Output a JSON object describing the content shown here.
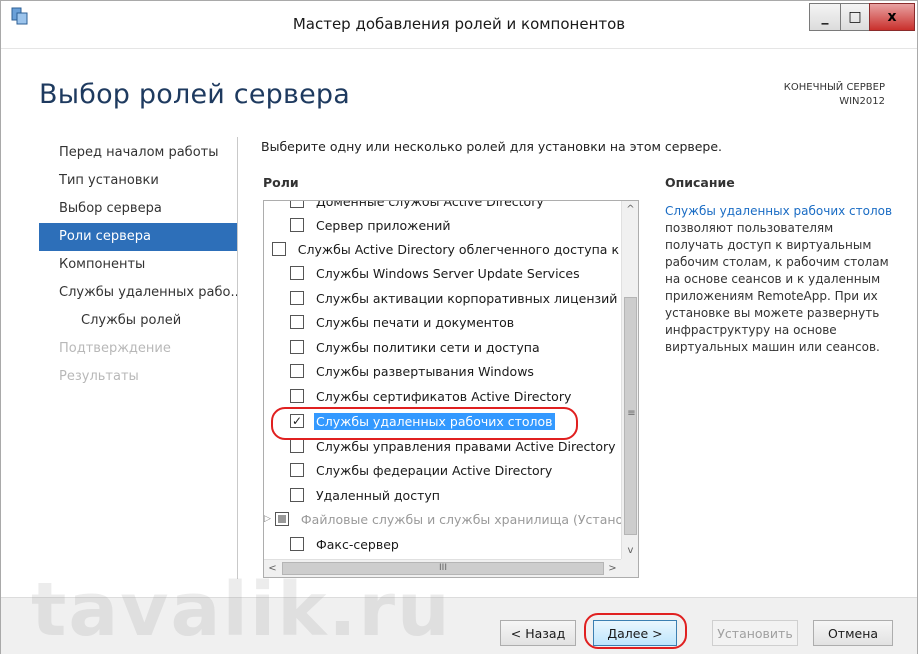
{
  "window": {
    "title": "Мастер добавления ролей и компонентов",
    "controls": {
      "minimize": "_",
      "maximize": "□",
      "close": "x"
    }
  },
  "header": {
    "title": "Выбор ролей сервера",
    "server_label": "КОНЕЧНЫЙ СЕРВЕР",
    "server_name": "WIN2012"
  },
  "nav": {
    "items": [
      {
        "label": "Перед началом работы",
        "state": "normal"
      },
      {
        "label": "Тип установки",
        "state": "normal"
      },
      {
        "label": "Выбор сервера",
        "state": "normal"
      },
      {
        "label": "Роли сервера",
        "state": "active"
      },
      {
        "label": "Компоненты",
        "state": "normal"
      },
      {
        "label": "Службы удаленных рабо...",
        "state": "normal"
      },
      {
        "label": "Службы ролей",
        "state": "sub"
      },
      {
        "label": "Подтверждение",
        "state": "disabled"
      },
      {
        "label": "Результаты",
        "state": "disabled"
      }
    ]
  },
  "main": {
    "instruction": "Выберите одну или несколько ролей для установки на этом сервере.",
    "roles_heading": "Роли",
    "description_heading": "Описание",
    "roles": [
      {
        "label": "Доменные службы Active Directory",
        "checked": false
      },
      {
        "label": "Сервер приложений",
        "checked": false
      },
      {
        "label": "Службы Active Directory облегченного доступа к",
        "checked": false
      },
      {
        "label": "Службы Windows Server Update Services",
        "checked": false
      },
      {
        "label": "Службы активации корпоративных лицензий",
        "checked": false
      },
      {
        "label": "Службы печати и документов",
        "checked": false
      },
      {
        "label": "Службы политики сети и доступа",
        "checked": false
      },
      {
        "label": "Службы развертывания Windows",
        "checked": false
      },
      {
        "label": "Службы сертификатов Active Directory",
        "checked": false
      },
      {
        "label": "Службы удаленных рабочих столов",
        "checked": true,
        "selected": true
      },
      {
        "label": "Службы управления правами Active Directory",
        "checked": false
      },
      {
        "label": "Службы федерации Active Directory",
        "checked": false
      },
      {
        "label": "Удаленный доступ",
        "checked": false
      },
      {
        "label": "Файловые службы и службы хранилища (Устано",
        "checked": "partial",
        "expandable": true
      },
      {
        "label": "Факс-сервер",
        "checked": false
      }
    ],
    "scrollbar": {
      "up": "^",
      "down": "v",
      "grip": "≡",
      "left": "<",
      "right": ">",
      "hgrip": "III"
    },
    "description": {
      "link": "Службы удаленных рабочих столов",
      "text": " позволяют пользователям получать доступ к виртуальным рабочим столам, к рабочим столам на основе сеансов и к удаленным приложениям RemoteApp. При их установке вы можете развернуть инфраструктуру на основе виртуальных машин или сеансов."
    }
  },
  "footer": {
    "back_label": "< Назад",
    "next_label": "Далее >",
    "install_label": "Установить",
    "cancel_label": "Отмена"
  },
  "watermark": "tavalik.ru",
  "colors": {
    "accent": "#2d6fb9",
    "selection": "#3399ff",
    "link": "#1a6cc4",
    "highlight": "#e02020"
  }
}
